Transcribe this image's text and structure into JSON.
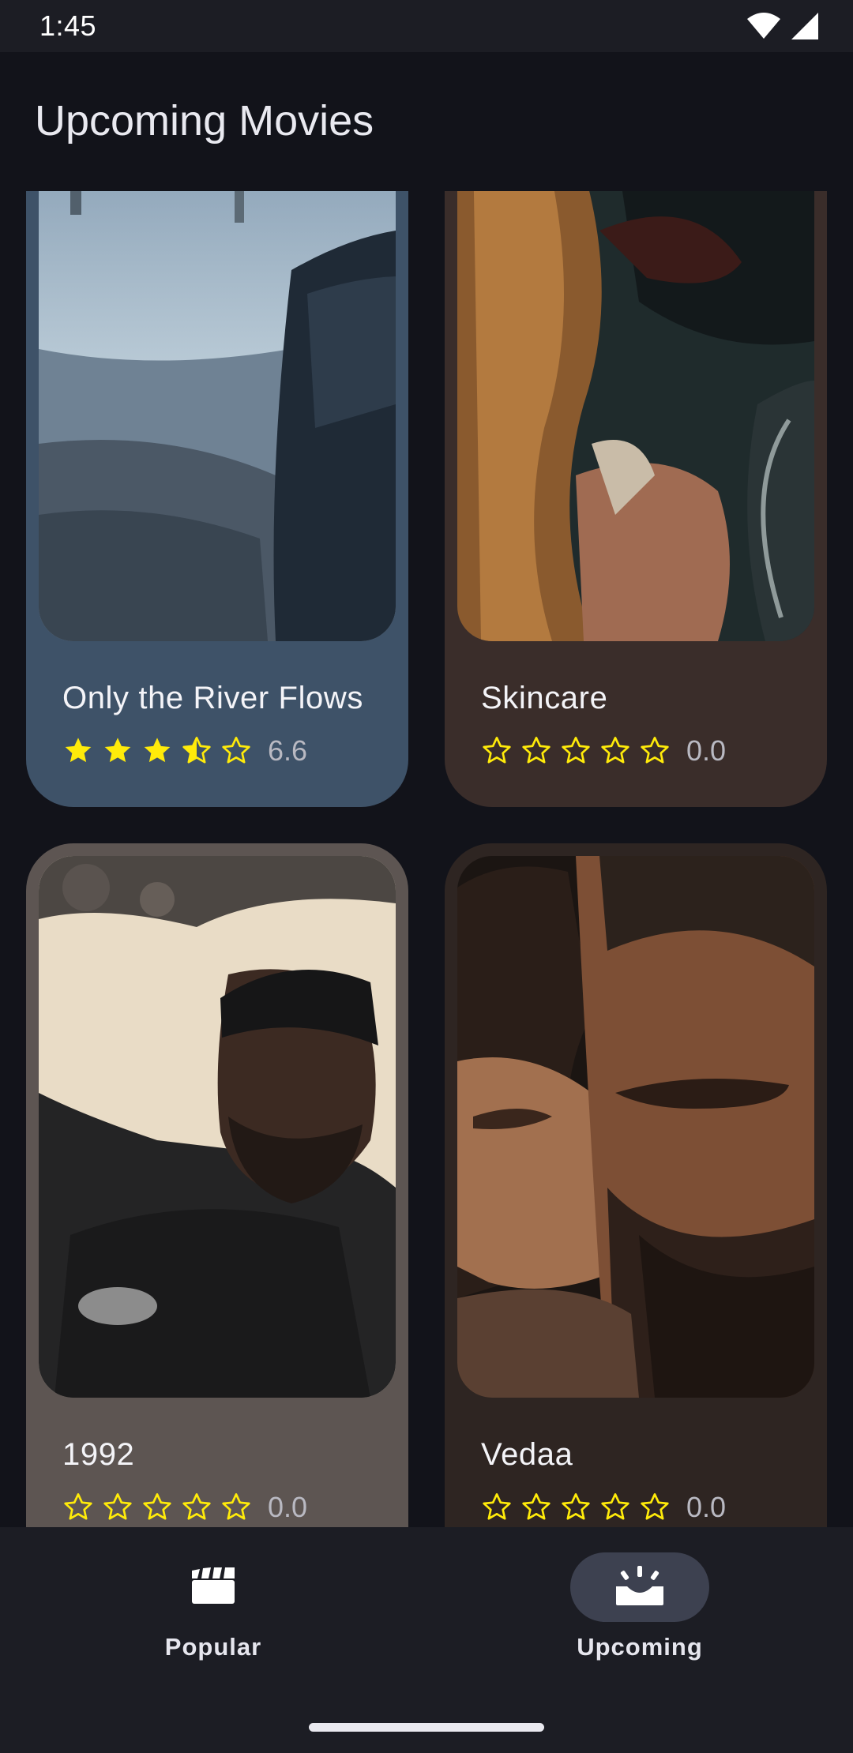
{
  "status_bar": {
    "time": "1:45"
  },
  "app_bar": {
    "title": "Upcoming Movies"
  },
  "movies": [
    {
      "title": "Only the River Flows",
      "rating": "6.6",
      "stars_filled": 3.5,
      "card_color": "#3e5268"
    },
    {
      "title": "Skincare",
      "rating": "0.0",
      "stars_filled": 0,
      "card_color": "#3a2d2a"
    },
    {
      "title": "1992",
      "rating": "0.0",
      "stars_filled": 0,
      "card_color": "#5d5552"
    },
    {
      "title": "Vedaa",
      "rating": "0.0",
      "stars_filled": 0,
      "card_color": "#2e2522"
    }
  ],
  "bottom_nav": {
    "items": [
      {
        "label": "Popular",
        "icon": "clapperboard-icon",
        "active": false
      },
      {
        "label": "Upcoming",
        "icon": "upcoming-release-icon",
        "active": true
      }
    ]
  },
  "colors": {
    "background": "#12131a",
    "star": "#ffeb0a",
    "nav_active_pill": "#3d4150"
  }
}
